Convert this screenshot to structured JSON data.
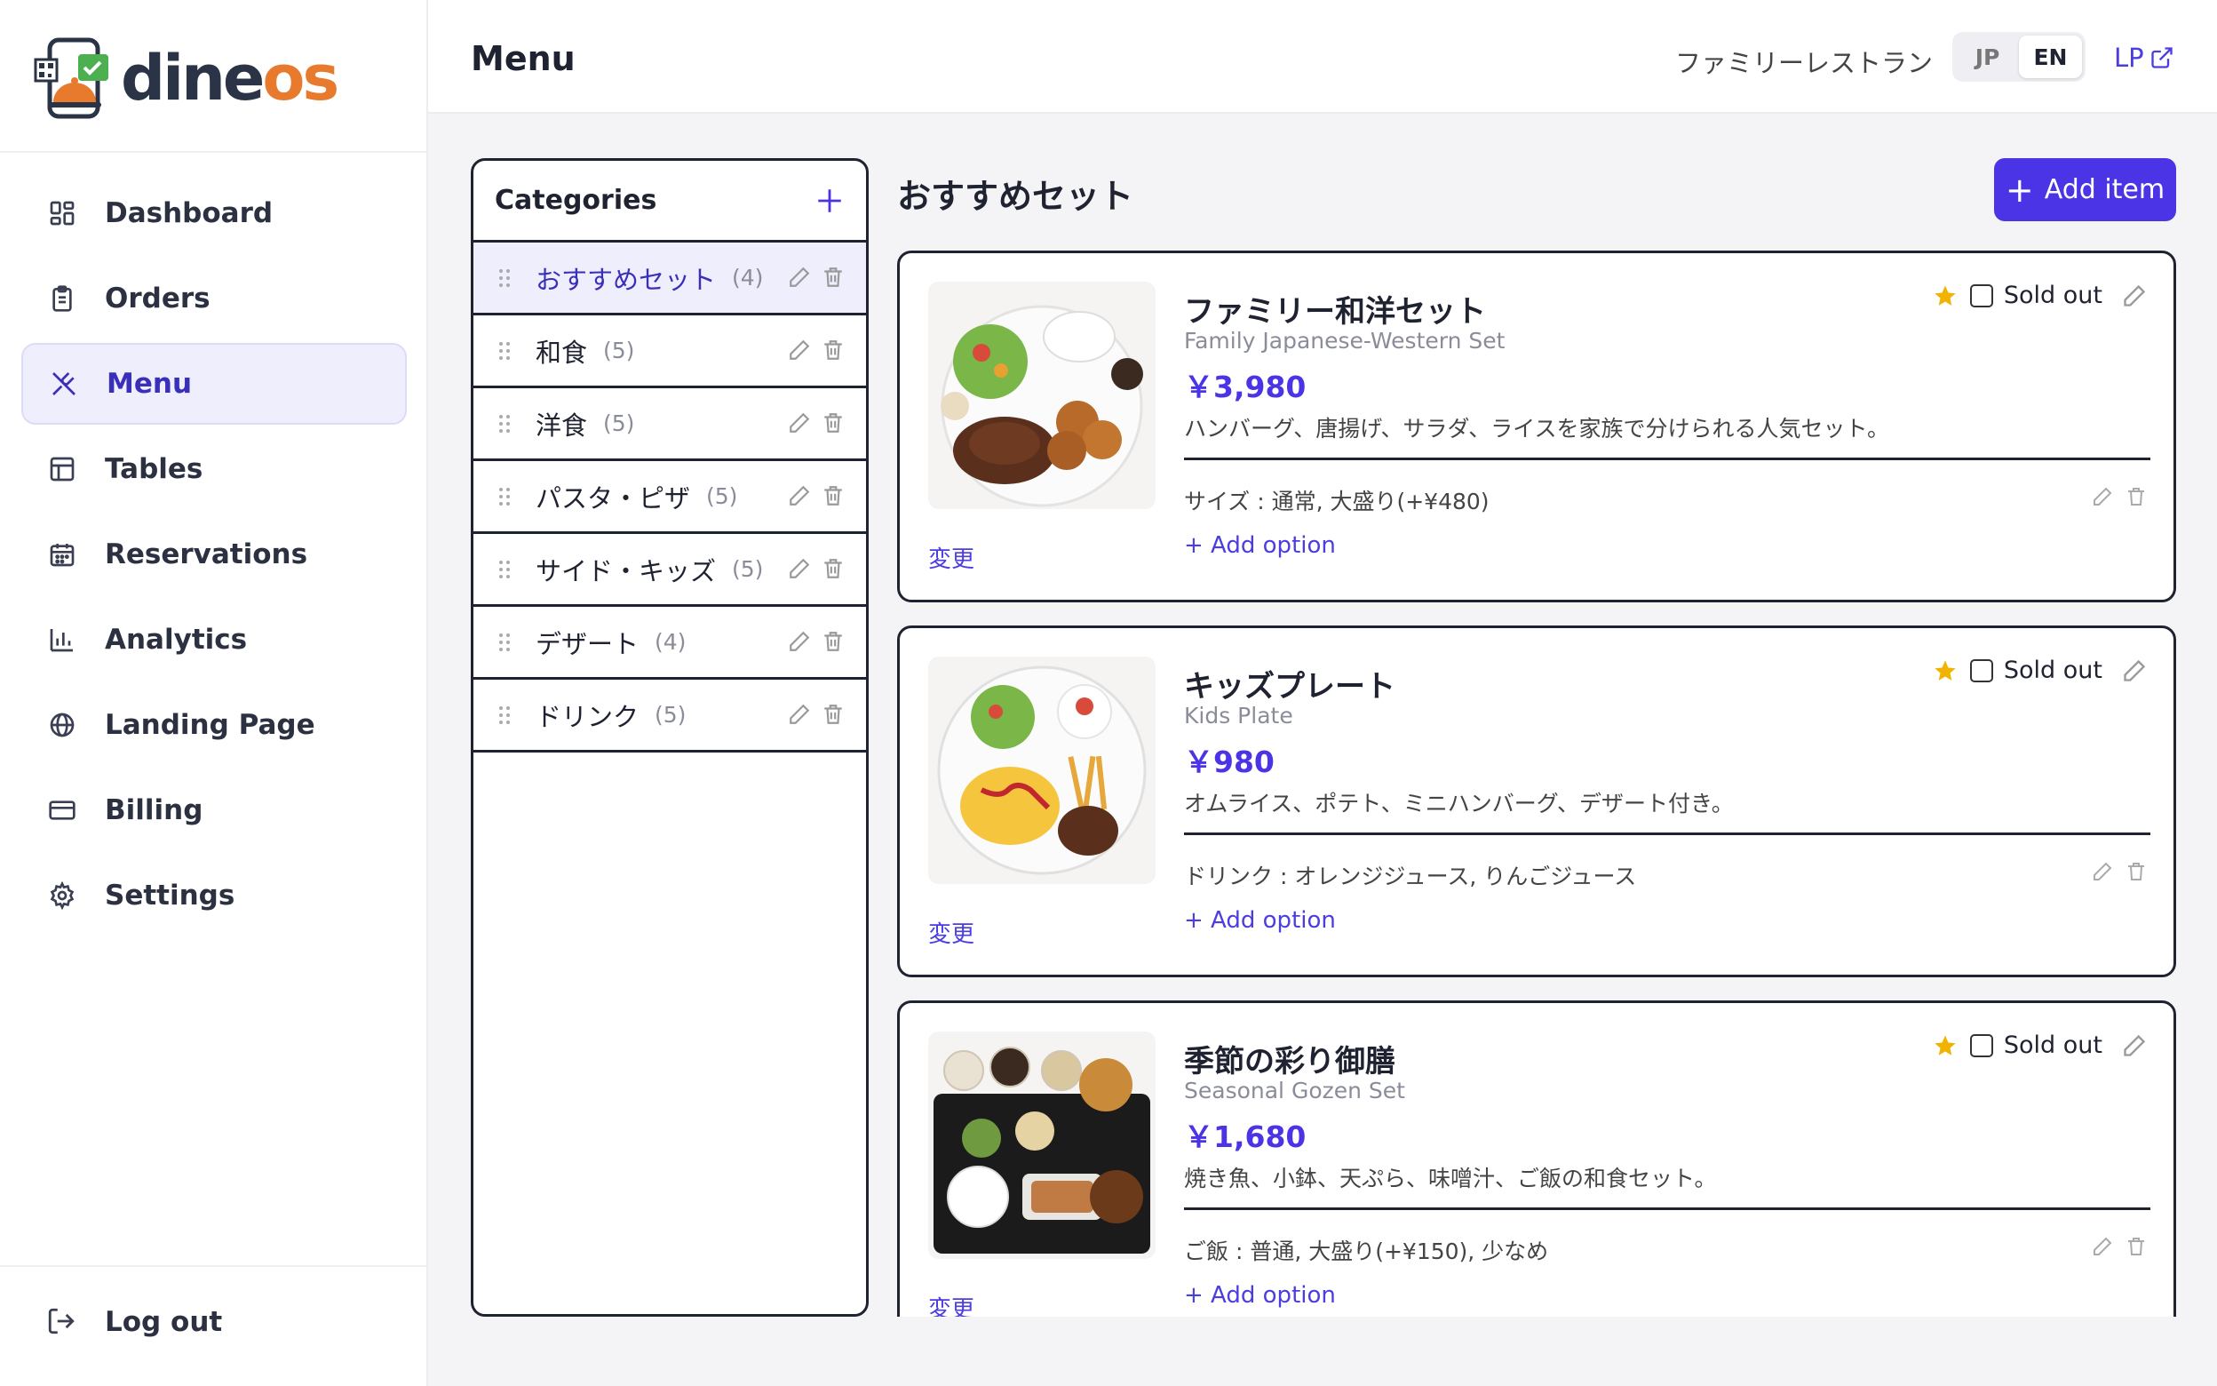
{
  "brand": {
    "name_part1": "dine",
    "name_part2": "os"
  },
  "sidebar": {
    "items": [
      {
        "label": "Dashboard",
        "icon": "grid-icon"
      },
      {
        "label": "Orders",
        "icon": "clipboard-icon"
      },
      {
        "label": "Menu",
        "icon": "utensils-icon",
        "active": true
      },
      {
        "label": "Tables",
        "icon": "table-icon"
      },
      {
        "label": "Reservations",
        "icon": "calendar-icon"
      },
      {
        "label": "Analytics",
        "icon": "bar-chart-icon"
      },
      {
        "label": "Landing Page",
        "icon": "globe-icon"
      },
      {
        "label": "Billing",
        "icon": "credit-card-icon"
      },
      {
        "label": "Settings",
        "icon": "gear-icon"
      }
    ],
    "logout": "Log out"
  },
  "header": {
    "title": "Menu",
    "restaurant": "ファミリーレストラン",
    "lang_jp": "JP",
    "lang_en": "EN",
    "lp_link": "LP"
  },
  "categories": {
    "title": "Categories",
    "items": [
      {
        "name": "おすすめセット",
        "count": "(4)"
      },
      {
        "name": "和食",
        "count": "(5)"
      },
      {
        "name": "洋食",
        "count": "(5)"
      },
      {
        "name": "パスタ・ピザ",
        "count": "(5)"
      },
      {
        "name": "サイド・キッズ",
        "count": "(5)"
      },
      {
        "name": "デザート",
        "count": "(4)"
      },
      {
        "name": "ドリンク",
        "count": "(5)"
      }
    ]
  },
  "section": {
    "title": "おすすめセット",
    "add_item": "Add item"
  },
  "items": [
    {
      "name": "ファミリー和洋セット",
      "subtitle": "Family Japanese-Western Set",
      "price": "￥3,980",
      "description": "ハンバーグ、唐揚げ、サラダ、ライスを家族で分けられる人気セット。",
      "option": "サイズ : 通常, 大盛り(+¥480)",
      "sold_out": "Sold out",
      "change": "変更",
      "add_option": "+ Add option"
    },
    {
      "name": "キッズプレート",
      "subtitle": "Kids Plate",
      "price": "￥980",
      "description": "オムライス、ポテト、ミニハンバーグ、デザート付き。",
      "option": "ドリンク : オレンジジュース, りんごジュース",
      "sold_out": "Sold out",
      "change": "変更",
      "add_option": "+ Add option"
    },
    {
      "name": "季節の彩り御膳",
      "subtitle": "Seasonal Gozen Set",
      "price": "￥1,680",
      "description": "焼き魚、小鉢、天ぷら、味噌汁、ご飯の和食セット。",
      "option": "ご飯 : 普通, 大盛り(+¥150), 少なめ",
      "sold_out": "Sold out",
      "change": "変更",
      "add_option": "+ Add option"
    }
  ],
  "colors": {
    "accent": "#4b34e6",
    "brand_orange": "#e77a2c",
    "star": "#f0b400"
  }
}
